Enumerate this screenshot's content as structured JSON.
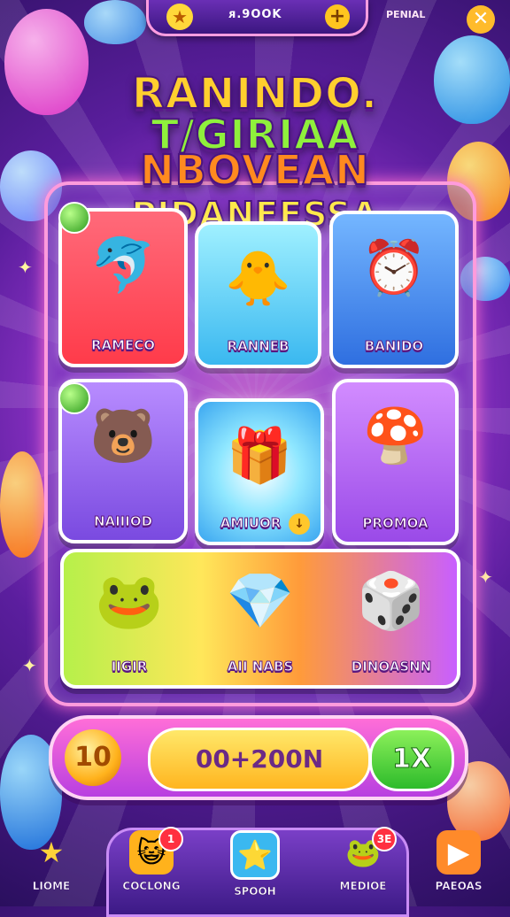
{
  "top": {
    "coin_amount": "ᴙ.9OOK",
    "signature": "PENIAL"
  },
  "title": {
    "line1": "RANINDO.",
    "line2": "T/GIRIAA",
    "line3": "NBOVEAN",
    "line4": "PIDANFESSA"
  },
  "grid": {
    "cards": [
      {
        "label": "RAMECO"
      },
      {
        "label": "RANNEB"
      },
      {
        "label": "BANIDO"
      },
      {
        "label": "NAIIIOD"
      },
      {
        "label": "AMIUOR"
      },
      {
        "label": "PROMOA"
      }
    ],
    "wide": [
      {
        "label": "IIGIR"
      },
      {
        "label": "AII NABS"
      },
      {
        "label": "DINOASNN"
      }
    ]
  },
  "bet": {
    "coin_symbol": "10",
    "amount": "00+200N",
    "multiplier": "1X"
  },
  "nav": {
    "items": [
      {
        "label": "LIOME"
      },
      {
        "label": "COCLONG",
        "badge": "1"
      },
      {
        "label": "S₱OOH"
      },
      {
        "label": "MEDIOE",
        "badge": "3E"
      },
      {
        "label": "PAEOAS"
      }
    ]
  },
  "colors": {
    "accent": "#ff6ed8",
    "bg_deep": "#2a0f5e",
    "gold": "#ffc51f",
    "green": "#2dbb2b"
  }
}
